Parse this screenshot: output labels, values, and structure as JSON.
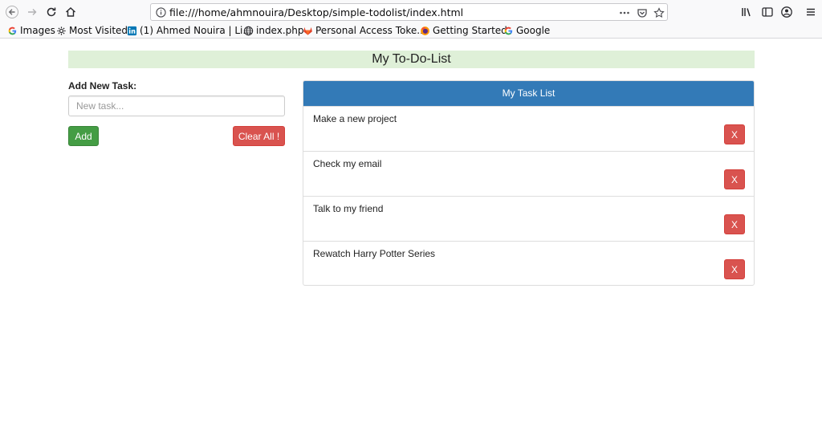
{
  "browser": {
    "url": "file:///home/ahmnouira/Desktop/simple-todolist/index.html",
    "bookmarks": [
      {
        "label": "Images",
        "icon": "google-icon"
      },
      {
        "label": "Most Visited",
        "icon": "gear-icon"
      },
      {
        "label": "(1) Ahmed Nouira | Li...",
        "icon": "linkedin-icon"
      },
      {
        "label": "index.php",
        "icon": "globe-icon"
      },
      {
        "label": "Personal Access Toke...",
        "icon": "gitlab-icon"
      },
      {
        "label": "Getting Started",
        "icon": "firefox-icon"
      },
      {
        "label": "Google",
        "icon": "google-icon"
      }
    ]
  },
  "page": {
    "title": "My To-Do-List",
    "add_label": "Add New Task:",
    "input_placeholder": "New task...",
    "add_button": "Add",
    "clear_button": "Clear All !",
    "panel_title": "My Task List",
    "remove_label": "X",
    "tasks": [
      "Make a new project",
      "Check my email",
      "Talk to my friend",
      "Rewatch Harry Potter Series"
    ]
  },
  "colors": {
    "header_bg": "#dff0d8",
    "panel_heading": "#337ab7",
    "add_button": "#449d44",
    "danger": "#d9534f"
  }
}
